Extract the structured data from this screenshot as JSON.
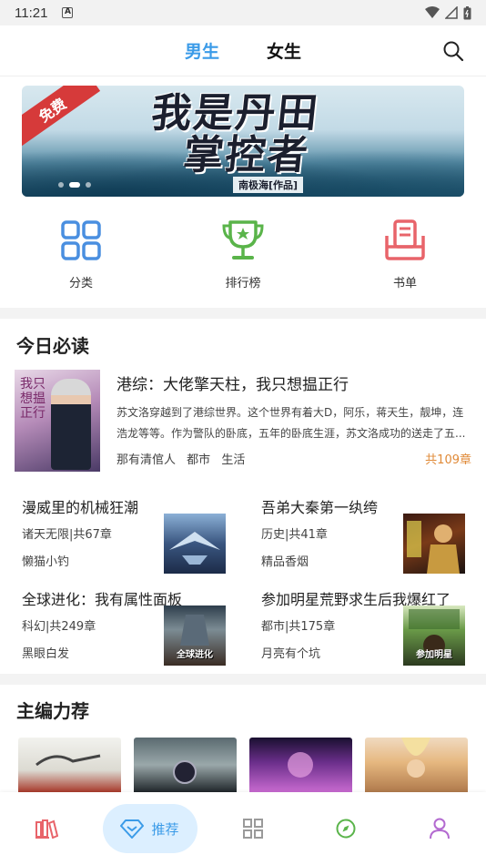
{
  "status_bar": {
    "time": "11:21",
    "notification_letter": "A"
  },
  "top_tabs": [
    {
      "label": "男生",
      "active": true
    },
    {
      "label": "女生",
      "active": false
    }
  ],
  "banner": {
    "title_line1": "我是丹田",
    "title_line2": "掌控者",
    "author": "南极海[作品]",
    "free_tag": "免费",
    "page_indicator": {
      "count": 3,
      "active_index": 1
    }
  },
  "quick_entries": [
    {
      "label": "分类",
      "icon": "grid-icon",
      "color": "#4a8fe0"
    },
    {
      "label": "排行榜",
      "icon": "trophy-icon",
      "color": "#5ab44a"
    },
    {
      "label": "书单",
      "icon": "booklist-icon",
      "color": "#e8646a"
    }
  ],
  "today_section": {
    "title": "今日必读",
    "featured": {
      "title": "港综：大佬擎天柱，我只想揾正行",
      "description": "苏文洛穿越到了港综世界。这个世界有着大D，阿乐，蒋天生，靓坤，连浩龙等等。作为警队的卧底，五年的卧底生涯，苏文洛成功的送走了五...",
      "author": "那有清倌人",
      "tags": [
        "都市",
        "生活"
      ],
      "chapters": "共109章",
      "cover_text": "我只想揾正行"
    },
    "books": [
      {
        "title": "漫威里的机械狂潮",
        "meta": "诸天无限|共67章",
        "author": "懒猫小钓",
        "cover": "cov-a",
        "cover_text": ""
      },
      {
        "title": "吾弟大秦第一纨绔",
        "meta": "历史|共41章",
        "author": "精品香烟",
        "cover": "cov-b",
        "cover_text": ""
      },
      {
        "title": "全球进化：我有属性面板",
        "meta": "科幻|共249章",
        "author": "黑眼白发",
        "cover": "cov-c",
        "cover_text": "全球进化"
      },
      {
        "title": "参加明星荒野求生后我爆红了",
        "meta": "都市|共175章",
        "author": "月亮有个坑",
        "cover": "cov-d",
        "cover_text": "参加明星"
      }
    ]
  },
  "editor_section": {
    "title": "主编力荐"
  },
  "bottom_nav": [
    {
      "icon": "bookshelf-icon",
      "label": "",
      "color": "#e8646a",
      "active": false
    },
    {
      "icon": "recommend-icon",
      "label": "推荐",
      "color": "#3b9be8",
      "active": true
    },
    {
      "icon": "category-icon",
      "label": "",
      "color": "#9a9a9a",
      "active": false
    },
    {
      "icon": "discover-icon",
      "label": "",
      "color": "#5ab44a",
      "active": false
    },
    {
      "icon": "profile-icon",
      "label": "",
      "color": "#b36ad0",
      "active": false
    }
  ]
}
